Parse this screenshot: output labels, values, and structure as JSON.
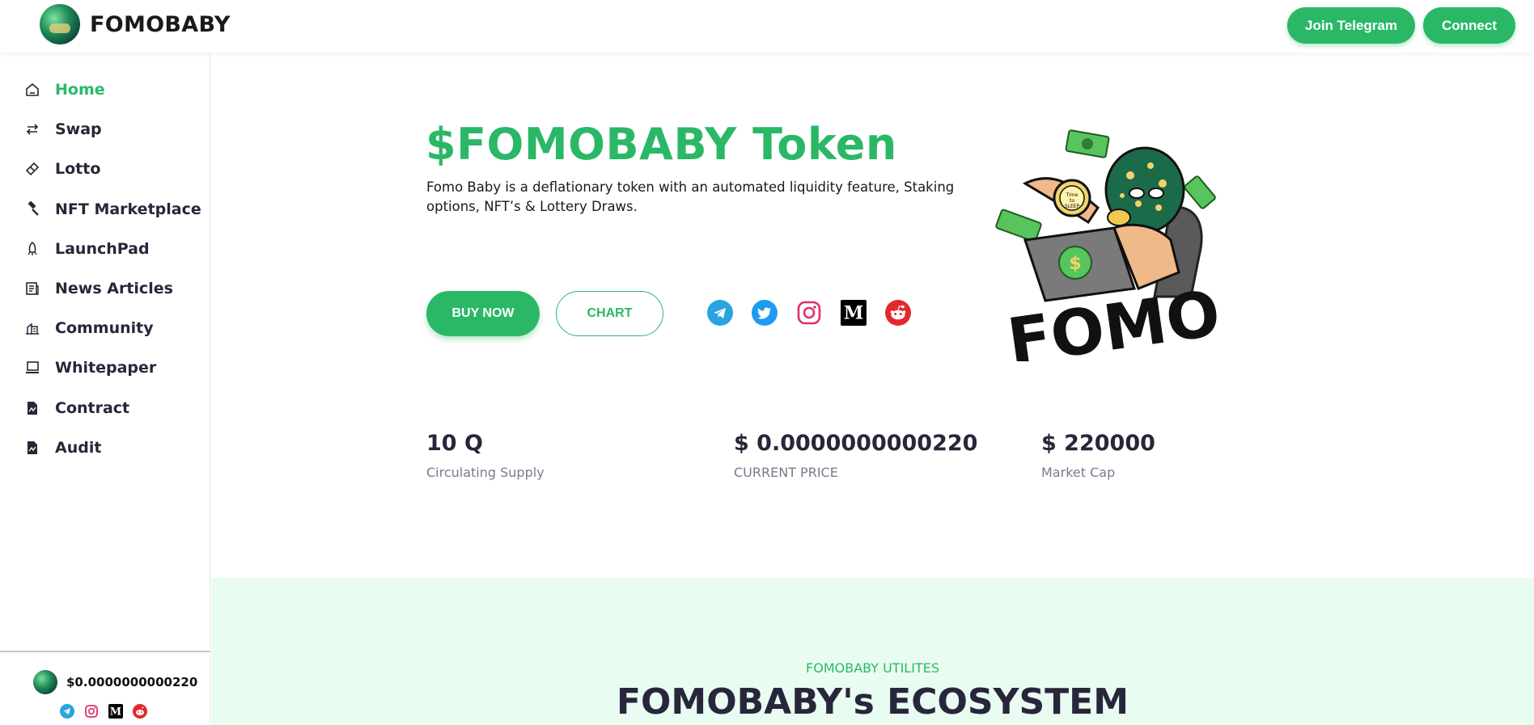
{
  "header": {
    "brand_name": "FOMOBABY",
    "join_telegram_label": "Join Telegram",
    "connect_label": "Connect"
  },
  "sidebar": {
    "items": [
      {
        "label": "Home",
        "icon": "home-icon",
        "active": true
      },
      {
        "label": "Swap",
        "icon": "swap-icon"
      },
      {
        "label": "Lotto",
        "icon": "ticket-icon"
      },
      {
        "label": "NFT Marketplace",
        "icon": "gavel-icon"
      },
      {
        "label": "LaunchPad",
        "icon": "rocket-icon"
      },
      {
        "label": "News Articles",
        "icon": "newspaper-icon"
      },
      {
        "label": "Community",
        "icon": "community-icon"
      },
      {
        "label": "Whitepaper",
        "icon": "laptop-icon"
      },
      {
        "label": "Contract",
        "icon": "document-icon"
      },
      {
        "label": "Audit",
        "icon": "document-icon"
      }
    ],
    "footer": {
      "price": "$0.0000000000220",
      "socials": [
        "telegram-icon",
        "instagram-icon",
        "medium-icon",
        "reddit-icon"
      ]
    }
  },
  "hero": {
    "title": "$FOMOBABY Token",
    "description": "Fomo Baby is a deflationary token with an automated liquidity feature, Staking options, NFT’s & Lottery Draws.",
    "buy_label": "BUY NOW",
    "chart_label": "CHART",
    "socials": [
      "telegram-icon",
      "twitter-icon",
      "instagram-icon",
      "medium-icon",
      "reddit-icon"
    ],
    "image_text": "FOMO"
  },
  "stats": [
    {
      "value": "10 Q",
      "label": "Circulating Supply"
    },
    {
      "value": "$ 0.0000000000220",
      "label": "CURRENT PRICE"
    },
    {
      "value": "$ 220000",
      "label": "Market Cap"
    }
  ],
  "ecosystem": {
    "kicker": "FOMOBABY UTILITES",
    "title": "FOMOBABY's ECOSYSTEM"
  },
  "colors": {
    "accent": "#2ab866",
    "text_dark": "#27263a",
    "eco_bg": "#e9fcf1",
    "telegram": "#2aa3e0",
    "twitter": "#1d9bf0",
    "instagram": "#e1306c",
    "medium": "#000000",
    "reddit": "#e3282e"
  }
}
